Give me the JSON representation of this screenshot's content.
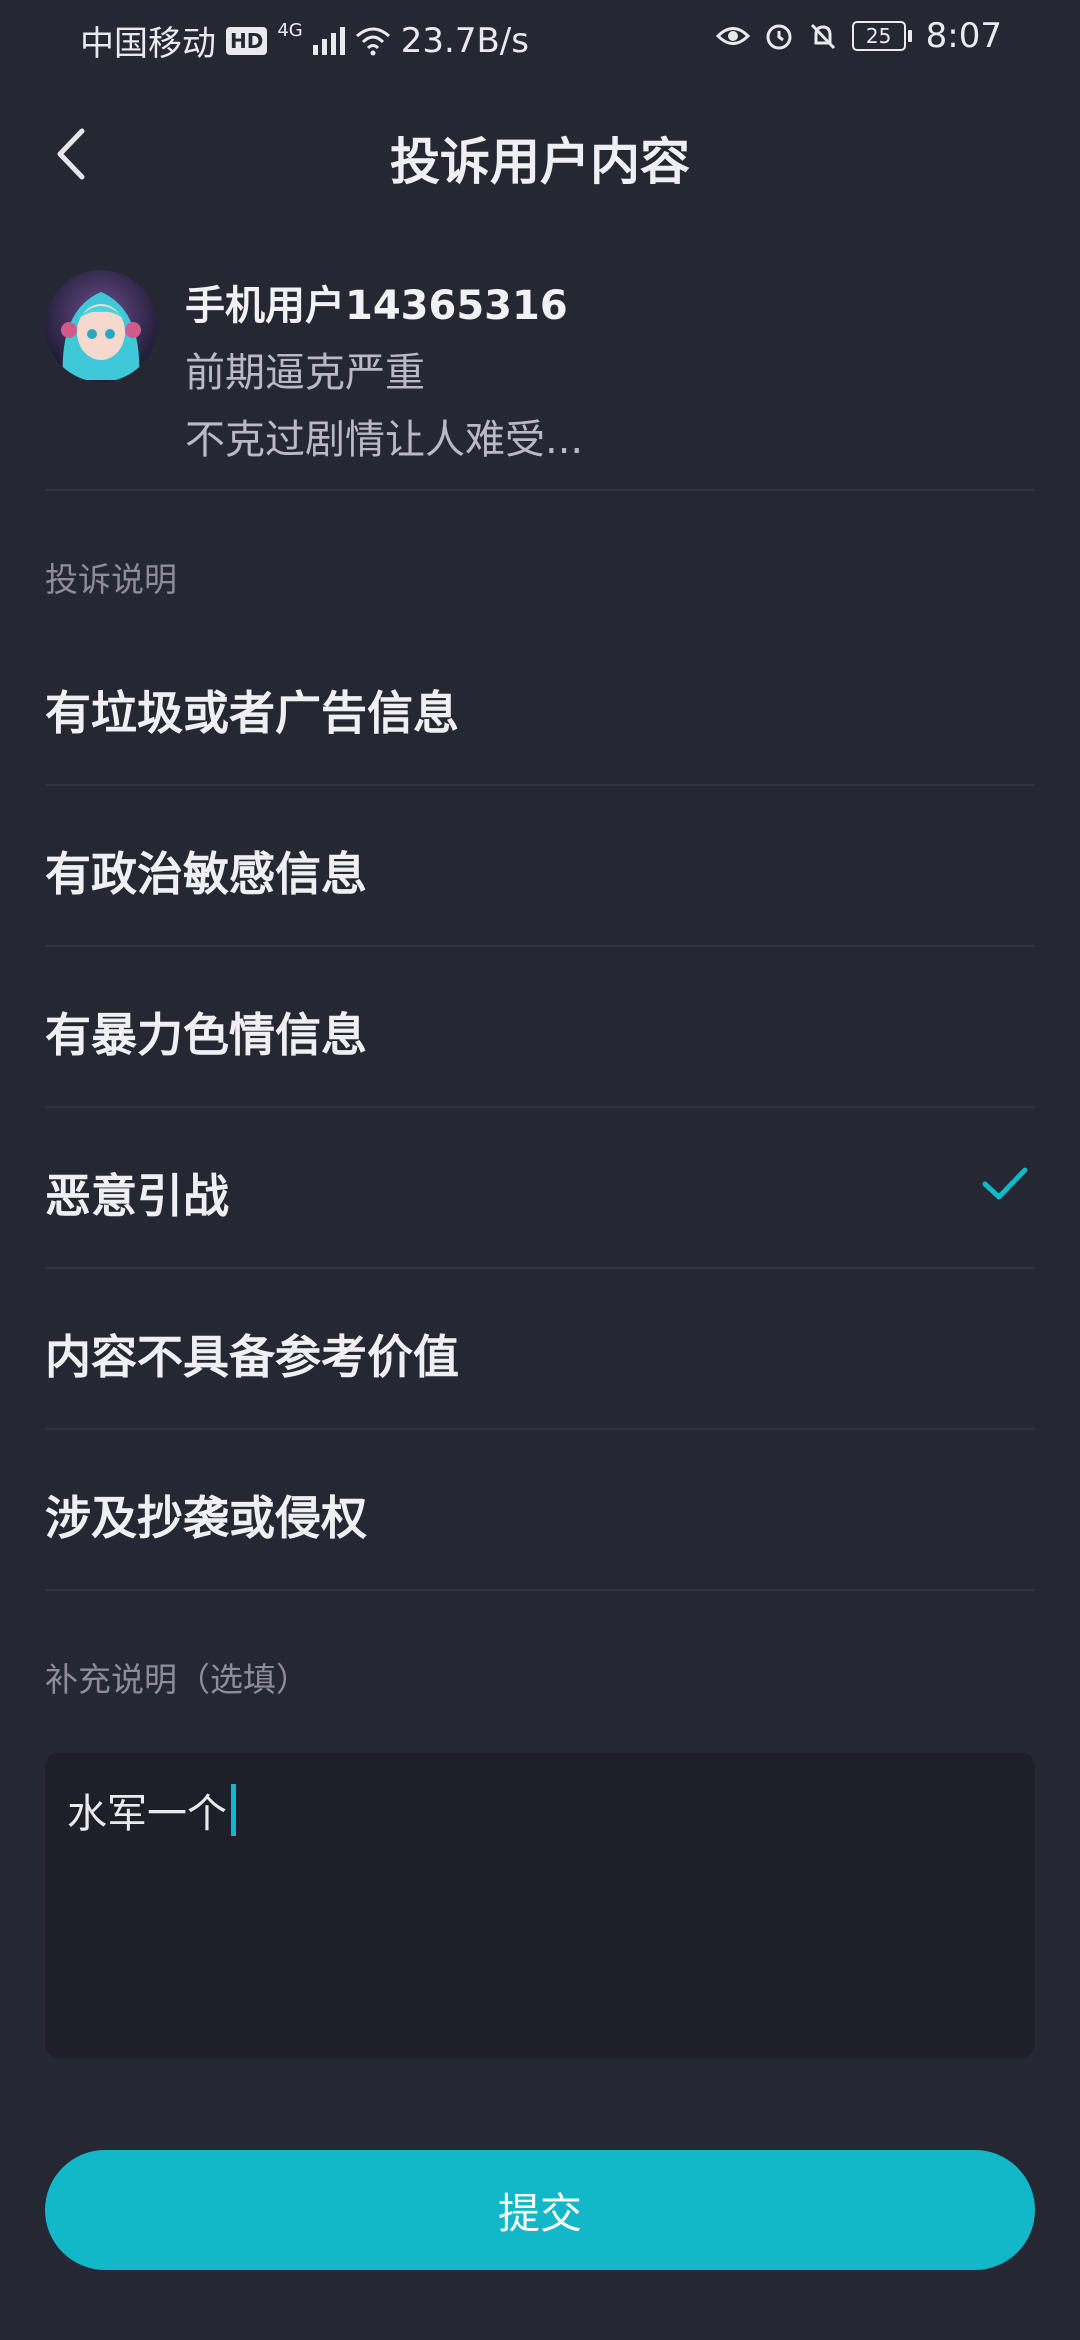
{
  "status_bar": {
    "carrier": "中国移动",
    "hd": "HD",
    "network": "4G",
    "speed": "23.7B/s",
    "battery": "25",
    "time": "8:07"
  },
  "header": {
    "title": "投诉用户内容"
  },
  "user": {
    "name": "手机用户14365316",
    "comment_line1": "前期逼克严重",
    "comment_line2": "不克过剧情让人难受..."
  },
  "complaint": {
    "section_label": "投诉说明",
    "options": [
      {
        "label": "有垃圾或者广告信息",
        "selected": false
      },
      {
        "label": "有政治敏感信息",
        "selected": false
      },
      {
        "label": "有暴力色情信息",
        "selected": false
      },
      {
        "label": "恶意引战",
        "selected": true
      },
      {
        "label": "内容不具备参考价值",
        "selected": false
      },
      {
        "label": "涉及抄袭或侵权",
        "selected": false
      }
    ]
  },
  "supplement": {
    "section_label": "补充说明（选填）",
    "value": "水军一个"
  },
  "submit_label": "提交",
  "colors": {
    "background": "#252733",
    "accent": "#12b8c8",
    "input_bg": "#1e1f29"
  }
}
